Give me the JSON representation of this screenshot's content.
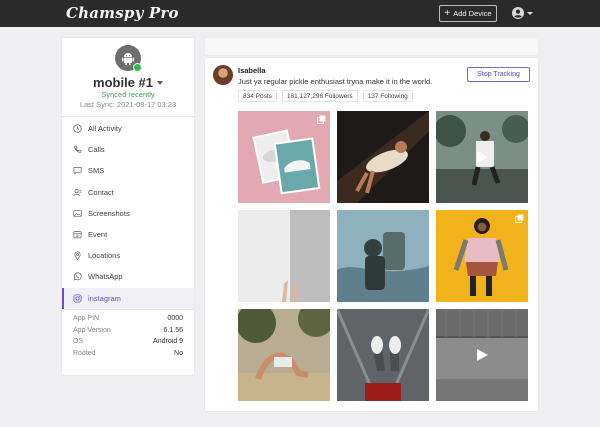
{
  "header": {
    "brand": "Chamspy Pro",
    "add_device_label": "Add Device",
    "user_icon": "user-circle-icon"
  },
  "device": {
    "name": "mobile #1",
    "status": "Synced recently",
    "last_sync": "Last Sync: 2021-08-17 03:23",
    "status_color": "#2fbb45"
  },
  "nav": [
    {
      "label": "All Activity",
      "icon": "clock-icon"
    },
    {
      "label": "Calls",
      "icon": "phone-icon"
    },
    {
      "label": "SMS",
      "icon": "message-icon"
    },
    {
      "label": "Contact",
      "icon": "contact-icon"
    },
    {
      "label": "Screenshots",
      "icon": "image-icon"
    },
    {
      "label": "Event",
      "icon": "calendar-icon"
    },
    {
      "label": "Locations",
      "icon": "location-pin-icon"
    },
    {
      "label": "WhatsApp",
      "icon": "whatsapp-icon"
    },
    {
      "label": "instagram",
      "icon": "instagram-icon",
      "active": true
    }
  ],
  "specs": [
    {
      "label": "App PIN",
      "value": "0000"
    },
    {
      "label": "App Version",
      "value": "6.1.56"
    },
    {
      "label": "OS",
      "value": "Android 9"
    },
    {
      "label": "Rooted",
      "value": "No"
    }
  ],
  "profile": {
    "username": "Isabella",
    "bio": "Just ya regular pickle enthusiast tryna make it in the world.",
    "stop_label": "Stop Tracking",
    "posts": "834 Posts",
    "followers": "181,127,296 Followers",
    "following": "137 Following"
  },
  "accent_color": "#6a4fc2",
  "posts_grid": [
    {
      "kind": "carousel",
      "subject": "sneaker-cards"
    },
    {
      "kind": "photo",
      "subject": "reclining-woman"
    },
    {
      "kind": "video",
      "subject": "seated-man-park"
    },
    {
      "kind": "photo",
      "subject": "hands-white-wall"
    },
    {
      "kind": "photo",
      "subject": "hiker-backpack"
    },
    {
      "kind": "carousel",
      "subject": "woman-yellow-wall"
    },
    {
      "kind": "photo",
      "subject": "yoga-pose"
    },
    {
      "kind": "photo",
      "subject": "feet-on-street"
    },
    {
      "kind": "video",
      "subject": "grey-street"
    }
  ]
}
